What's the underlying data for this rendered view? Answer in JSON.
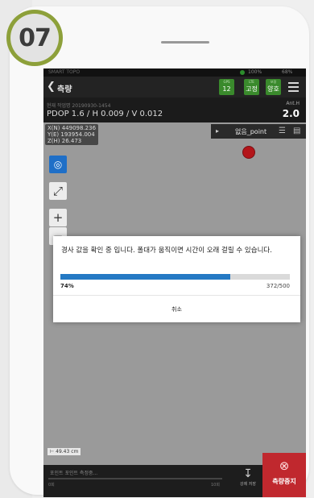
{
  "step_badge": "07",
  "status_bar": {
    "carrier": "SMART TOPO",
    "signal": "100%",
    "battery": "68%",
    "status_color": "#2c8c2c"
  },
  "top_bar": {
    "back_icon": "chevron-left-icon",
    "title": "측량",
    "chips": [
      {
        "title": "GPS",
        "value": "12"
      },
      {
        "title": "LTE",
        "value": "고정"
      },
      {
        "title": "보정",
        "value": "양호"
      }
    ],
    "chip_color": "#3a8a2c",
    "menu_icon": "hamburger-icon"
  },
  "info_bar": {
    "session": "현재 작업명 20190930-1454",
    "precision": "PDOP 1.6 / H 0.009 / V 0.012",
    "ant_label": "Ant.H",
    "ant_value": "2.0"
  },
  "map": {
    "coord_x": "X(N) 449098.236",
    "coord_y": "Y(E) 193954.004",
    "coord_z": "Z(H) 26.473",
    "point_name": "없음_point",
    "marker_color": "#b3151a",
    "scale": "49.43 cm"
  },
  "dialog": {
    "message": "경사 값을 확인 중 입니다. 폴대가 움직이면 시간이 오래 걸릴 수 있습니다.",
    "percent_label": "74%",
    "progress_fraction": 0.74,
    "count_label": "372/500",
    "cancel_label": "취소",
    "progress_color": "#2479c4"
  },
  "bottom_bar": {
    "status_label": "포인트 포인트 측정중...",
    "range_min": "0회",
    "range_max": "10회",
    "save_label": "강제 저장",
    "stop_label": "측량중지",
    "stop_color": "#c0282e"
  }
}
